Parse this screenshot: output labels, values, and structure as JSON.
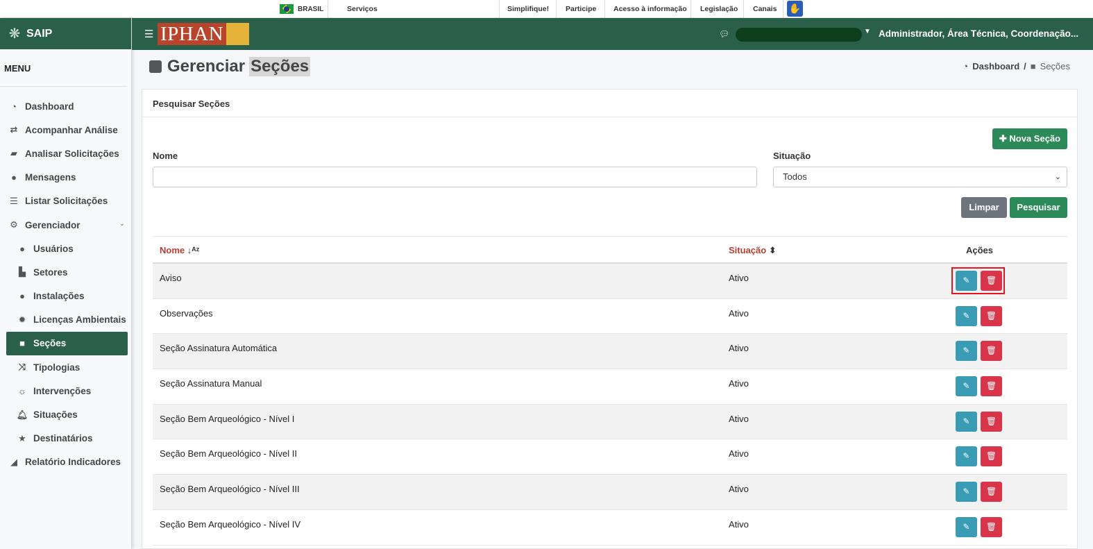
{
  "govbar": {
    "country": "BRASIL",
    "links": [
      "Serviços",
      "Simplifique!",
      "Participe",
      "Acesso à informação",
      "Legislação",
      "Canais"
    ]
  },
  "sidebar": {
    "brand": "SAIP",
    "menu_title": "MENU",
    "items": [
      {
        "label": "Dashboard",
        "icon": "dashboard-icon",
        "level": 1
      },
      {
        "label": "Acompanhar Análise",
        "icon": "exchange-icon",
        "level": 1
      },
      {
        "label": "Analisar Solicitações",
        "icon": "book-icon",
        "level": 1
      },
      {
        "label": "Mensagens",
        "icon": "comments-icon",
        "level": 1
      },
      {
        "label": "Listar Solicitações",
        "icon": "list-icon",
        "level": 1
      },
      {
        "label": "Gerenciador",
        "icon": "cogs-icon",
        "level": 1
      },
      {
        "label": "Usuários",
        "icon": "users-icon",
        "level": 2
      },
      {
        "label": "Setores",
        "icon": "industry-icon",
        "level": 2
      },
      {
        "label": "Instalações",
        "icon": "circle-icon",
        "level": 2
      },
      {
        "label": "Licenças Ambientais",
        "icon": "certificate-icon",
        "level": 2
      },
      {
        "label": "Seções",
        "icon": "square-icon",
        "level": 2
      },
      {
        "label": "Tipologias",
        "icon": "random-icon",
        "level": 2
      },
      {
        "label": "Intervenções",
        "icon": "sun-icon",
        "level": 2
      },
      {
        "label": "Situações",
        "icon": "bell-icon",
        "level": 2
      },
      {
        "label": "Destinatários",
        "icon": "star-icon",
        "level": 2
      },
      {
        "label": "Relatório Indicadores",
        "icon": "area-chart-icon",
        "level": 1
      }
    ]
  },
  "header": {
    "logo_text": "IPHAN",
    "user": "Administrador, Área Técnica, Coordenação..."
  },
  "page": {
    "title_prefix": "Gerenciar",
    "title_highlight": "Seções",
    "breadcrumb_home": "Dashboard",
    "breadcrumb_sep": "/",
    "breadcrumb_current": "Seções"
  },
  "search": {
    "card_title": "Pesquisar Seções",
    "new_button": "Nova Seção",
    "name_label": "Nome",
    "name_value": "",
    "status_label": "Situação",
    "status_selected": "Todos",
    "clear_button": "Limpar",
    "search_button": "Pesquisar"
  },
  "table": {
    "headers": {
      "nome": "Nome",
      "situacao": "Situação",
      "acoes": "Ações"
    },
    "rows": [
      {
        "nome": "Aviso",
        "situacao": "Ativo"
      },
      {
        "nome": "Observações",
        "situacao": "Ativo"
      },
      {
        "nome": "Seção Assinatura Automática",
        "situacao": "Ativo"
      },
      {
        "nome": "Seção Assinatura Manual",
        "situacao": "Ativo"
      },
      {
        "nome": "Seção Bem Arqueológico - Nível I",
        "situacao": "Ativo"
      },
      {
        "nome": "Seção Bem Arqueológico - Nível II",
        "situacao": "Ativo"
      },
      {
        "nome": "Seção Bem Arqueológico - Nível III",
        "situacao": "Ativo"
      },
      {
        "nome": "Seção Bem Arqueológico - Nível IV",
        "situacao": "Ativo"
      }
    ]
  },
  "colors": {
    "primary_green": "#2a6049",
    "button_green": "#2b8a58",
    "edit_blue": "#3a9bb5",
    "delete_red": "#d9354a",
    "header_link_red": "#b53e31",
    "highlight_border": "#e5141e"
  }
}
